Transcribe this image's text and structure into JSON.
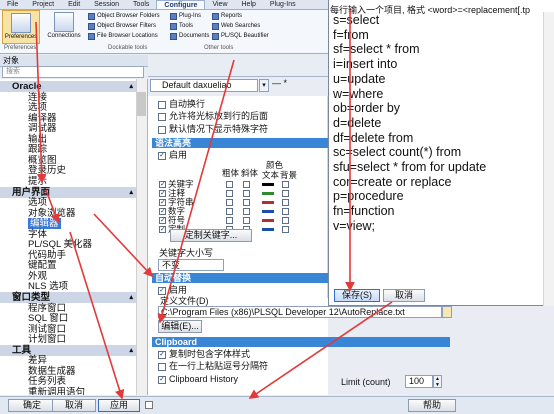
{
  "ribbon": {
    "tabs": [
      "File",
      "Project",
      "Edit",
      "Session",
      "Tools",
      "Configure",
      "View",
      "Help",
      "Plug-Ins"
    ],
    "active_tab": "Configure",
    "preferences_label": "Preferences",
    "connections_label": "Connections",
    "object_browser_folders": "Object Browser Folders",
    "object_browser_filters": "Object Browser Filters",
    "file_browser_locations": "File Browser Locations",
    "plugins": "Plug-Ins",
    "tools": "Tools",
    "documents": "Documents",
    "reports": "Reports",
    "web_searches": "Web Searches",
    "plsql_beautifier": "PL/SQL Beautifier",
    "group_preferences": "Preferences",
    "group_dockable": "Dockable tools",
    "group_other": "Other tools"
  },
  "tree": {
    "panel_title": "对象",
    "search_placeholder": "搜索",
    "lines": [
      {
        "text": "Oracle",
        "type": "cat"
      },
      {
        "text": "连接",
        "type": "item"
      },
      {
        "text": "选项",
        "type": "item"
      },
      {
        "text": "编译器",
        "type": "item"
      },
      {
        "text": "调试器",
        "type": "item"
      },
      {
        "text": "输出",
        "type": "item"
      },
      {
        "text": "跟踪",
        "type": "item"
      },
      {
        "text": "概览图",
        "type": "item"
      },
      {
        "text": "登录历史",
        "type": "item"
      },
      {
        "text": "提示",
        "type": "item"
      },
      {
        "text": "用户界面",
        "type": "cat"
      },
      {
        "text": "选项",
        "type": "item"
      },
      {
        "text": "对象浏览器",
        "type": "item"
      },
      {
        "text": "编辑器",
        "type": "sel"
      },
      {
        "text": "字体",
        "type": "item"
      },
      {
        "text": "PL/SQL 美化器",
        "type": "item"
      },
      {
        "text": "代码助手",
        "type": "item"
      },
      {
        "text": "键配置",
        "type": "item"
      },
      {
        "text": "外观",
        "type": "item"
      },
      {
        "text": "NLS 选项",
        "type": "item"
      },
      {
        "text": "窗口类型",
        "type": "cat"
      },
      {
        "text": "程序窗口",
        "type": "item"
      },
      {
        "text": "SQL 窗口",
        "type": "item"
      },
      {
        "text": "测试窗口",
        "type": "item"
      },
      {
        "text": "计划窗口",
        "type": "item"
      },
      {
        "text": "工具",
        "type": "cat"
      },
      {
        "text": "差异",
        "type": "item"
      },
      {
        "text": "数据生成器",
        "type": "item"
      },
      {
        "text": "任务列表",
        "type": "item"
      },
      {
        "text": "重新调用语句",
        "type": "item"
      }
    ]
  },
  "settings": {
    "profile": "Default daxueliao",
    "profile_dash": "— *",
    "auto_wrap": "自动换行",
    "allow_cursor": "允许将光标放到行的后面",
    "show_special": "默认情况下显示特殊字符",
    "syntax_section": "语法高亮",
    "enable": "启用",
    "col_bold": "粗体",
    "col_italic": "斜体",
    "col_color": "颜色",
    "col_text": "文本",
    "col_background": "背景",
    "rows": [
      "关键字",
      "注释",
      "字符串",
      "数字",
      "符号",
      "定制"
    ],
    "custom_keywords_button": "定制关键字...",
    "keyword_case_label": "关键字大小写",
    "keyword_case_value": "不变",
    "autoreplace_section": "自动替换",
    "autoreplace_enable": "启用",
    "definition_file_label": "定义文件(D)",
    "definition_file_path": "C:\\Program Files (x86)\\PLSQL Developer 12\\AutoReplace.txt",
    "edit_button": "编辑(E)...",
    "clipboard_section": "Clipboard",
    "copy_font_style": "复制时包含字体样式",
    "paste_one_line": "在一行上粘贴逗号分隔符",
    "clipboard_history": "Clipboard History",
    "limit_label": "Limit (count)",
    "limit_value": "100"
  },
  "editor": {
    "header": "每行输入一个项目, 格式 <word>=<replacement[.tp",
    "lines": [
      "s=select",
      "f=from",
      "sf=select * from",
      "i=insert into",
      "u=update",
      "w=where",
      "ob=order by",
      "d=delete",
      "df=delete from",
      "sc=select count(*) from",
      "sfu=select * from for update",
      "cor=create or replace",
      "p=procedure",
      "fn=function",
      "v=view;"
    ],
    "save_button": "保存(S)",
    "cancel_button": "取消"
  },
  "footer": {
    "ok": "确定",
    "cancel": "取消",
    "apply": "应用",
    "help": "帮助"
  },
  "colors": {
    "section_blue": "#3a86d6",
    "selection_blue": "#3b78d8",
    "arrow_red": "#e23a3a",
    "keyword_color": "#000000",
    "comment_color": "#2e8b2e",
    "string_color": "#b03030",
    "number_color": "#1a4fa8",
    "symbol_color": "#b03030",
    "custom_color": "#1a4fa8"
  }
}
